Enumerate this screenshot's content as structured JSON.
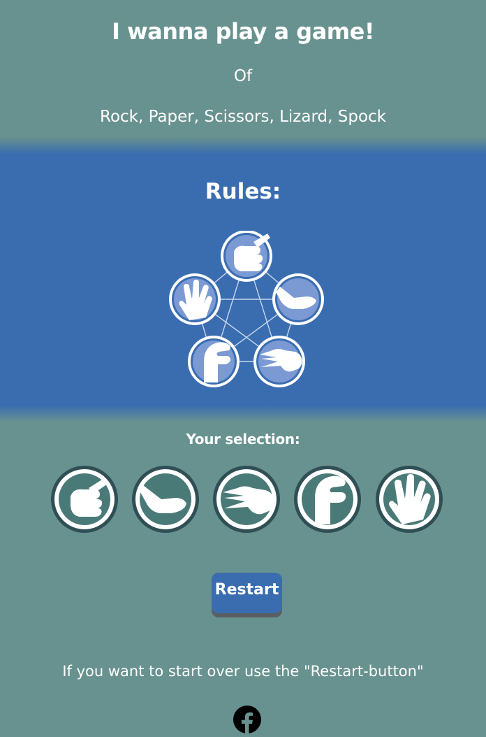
{
  "header": {
    "title": "I wanna play a game!",
    "of_text": "Of",
    "subtitle": "Rock, Paper, Scissors, Lizard, Spock"
  },
  "rules": {
    "title": "Rules:",
    "diagram_icons": [
      "rock-hand-icon",
      "paper-hand-icon",
      "scissors-hand-icon",
      "lizard-hand-icon",
      "spock-hand-icon"
    ]
  },
  "selection": {
    "label": "Your selection:",
    "choices": [
      "rock",
      "paper",
      "scissors",
      "lizard",
      "spock"
    ]
  },
  "restart_label": "Restart",
  "hint": "If you want to start over use the \"Restart-button\"",
  "footer": {
    "social_icon": "facebook-icon"
  },
  "colors": {
    "background": "#68928f",
    "rules_band": "#3a6db0",
    "button": "#3a6db0",
    "choice_fill": "#4a7a78",
    "choice_ring": "#2f4f55",
    "diagram_fill": "#7b9ad4"
  }
}
